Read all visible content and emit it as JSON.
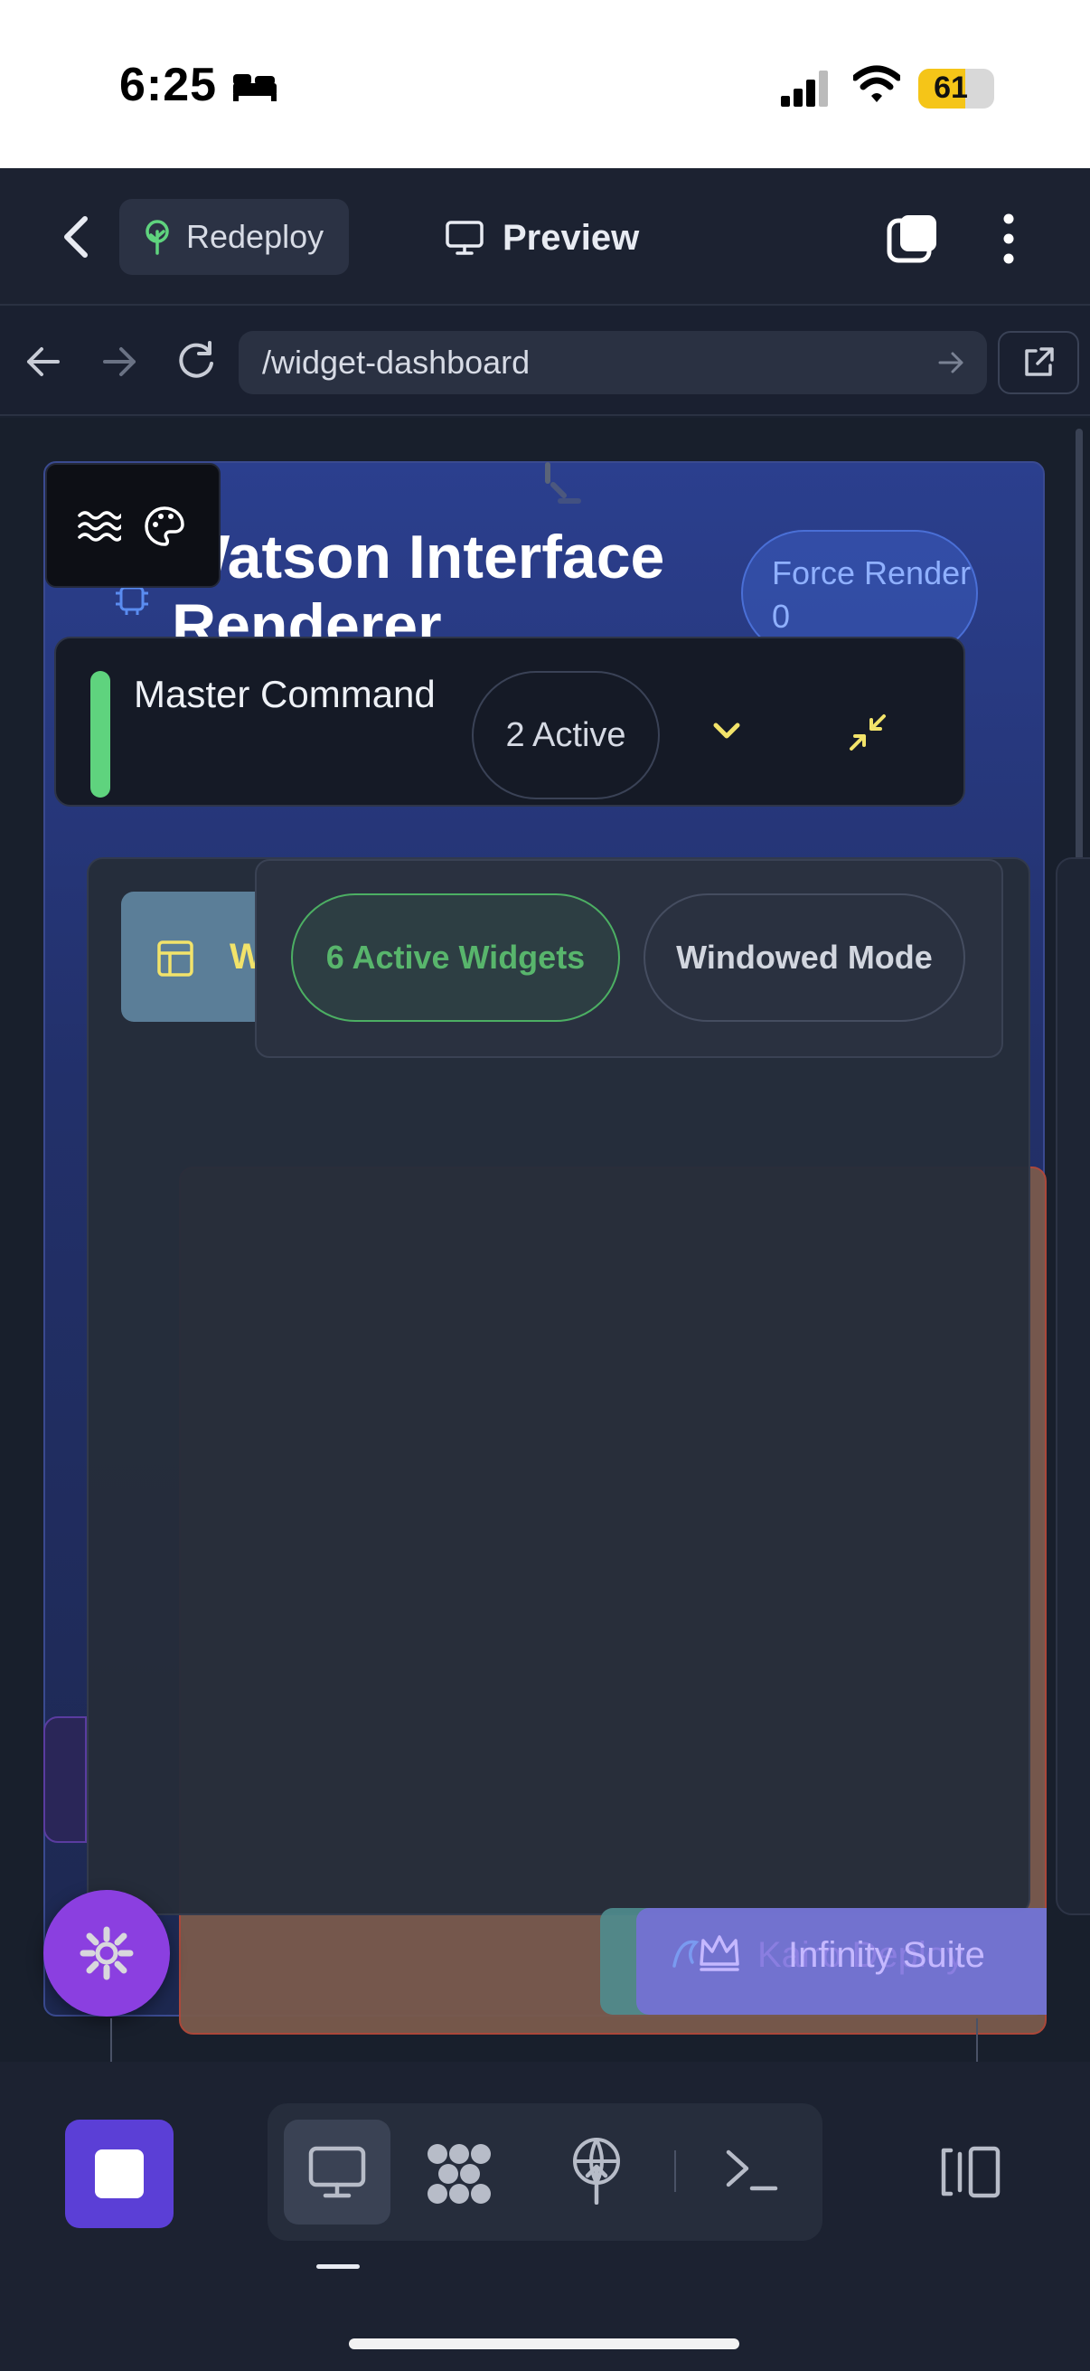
{
  "status_bar": {
    "time": "6:25",
    "battery": "61",
    "icons": [
      "bed-icon",
      "signal-icon",
      "wifi-icon",
      "battery-icon"
    ]
  },
  "header": {
    "redeploy_label": "Redeploy",
    "preview_label": "Preview"
  },
  "browser": {
    "url": "/widget-dashboard"
  },
  "site": {
    "title": "Watson Interface Renderer",
    "force_render": "Force Render 0"
  },
  "master_command": {
    "label": "Master Command",
    "active_count": "2 Active"
  },
  "widgets": {
    "tile_letter": "W",
    "active_widgets": "6 Active Widgets",
    "windowed_mode": "Windowed Mode"
  },
  "suite": {
    "label_a": "Kairo Deploy",
    "label_b": "Infinity Suite"
  },
  "colors": {
    "accent_purple": "#8b3fe0",
    "accent_green": "#5fd37e",
    "accent_yellow": "#f2e36a",
    "stop_button": "#5b3fd6"
  }
}
